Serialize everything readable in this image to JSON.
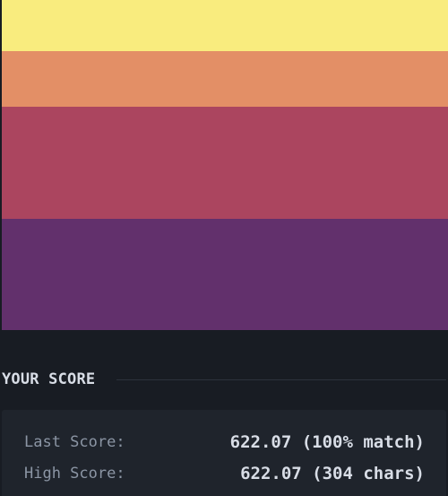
{
  "preview": {
    "stripes": [
      {
        "name": "stripe-yellow",
        "color": "#f9ec7e"
      },
      {
        "name": "stripe-orange",
        "color": "#e38f66"
      },
      {
        "name": "stripe-red",
        "color": "#ab455f"
      },
      {
        "name": "stripe-purple",
        "color": "#62306c"
      }
    ]
  },
  "score": {
    "heading": "YOUR SCORE",
    "last_label": "Last Score:",
    "last_value": "622.07 (100% match)",
    "high_label": "High Score:",
    "high_value": "622.07 (304 chars)"
  },
  "colors": {
    "background": "#181c23",
    "panel": "#1f242c",
    "heading_text": "#d8dde6",
    "label_text": "#8b95a4"
  }
}
